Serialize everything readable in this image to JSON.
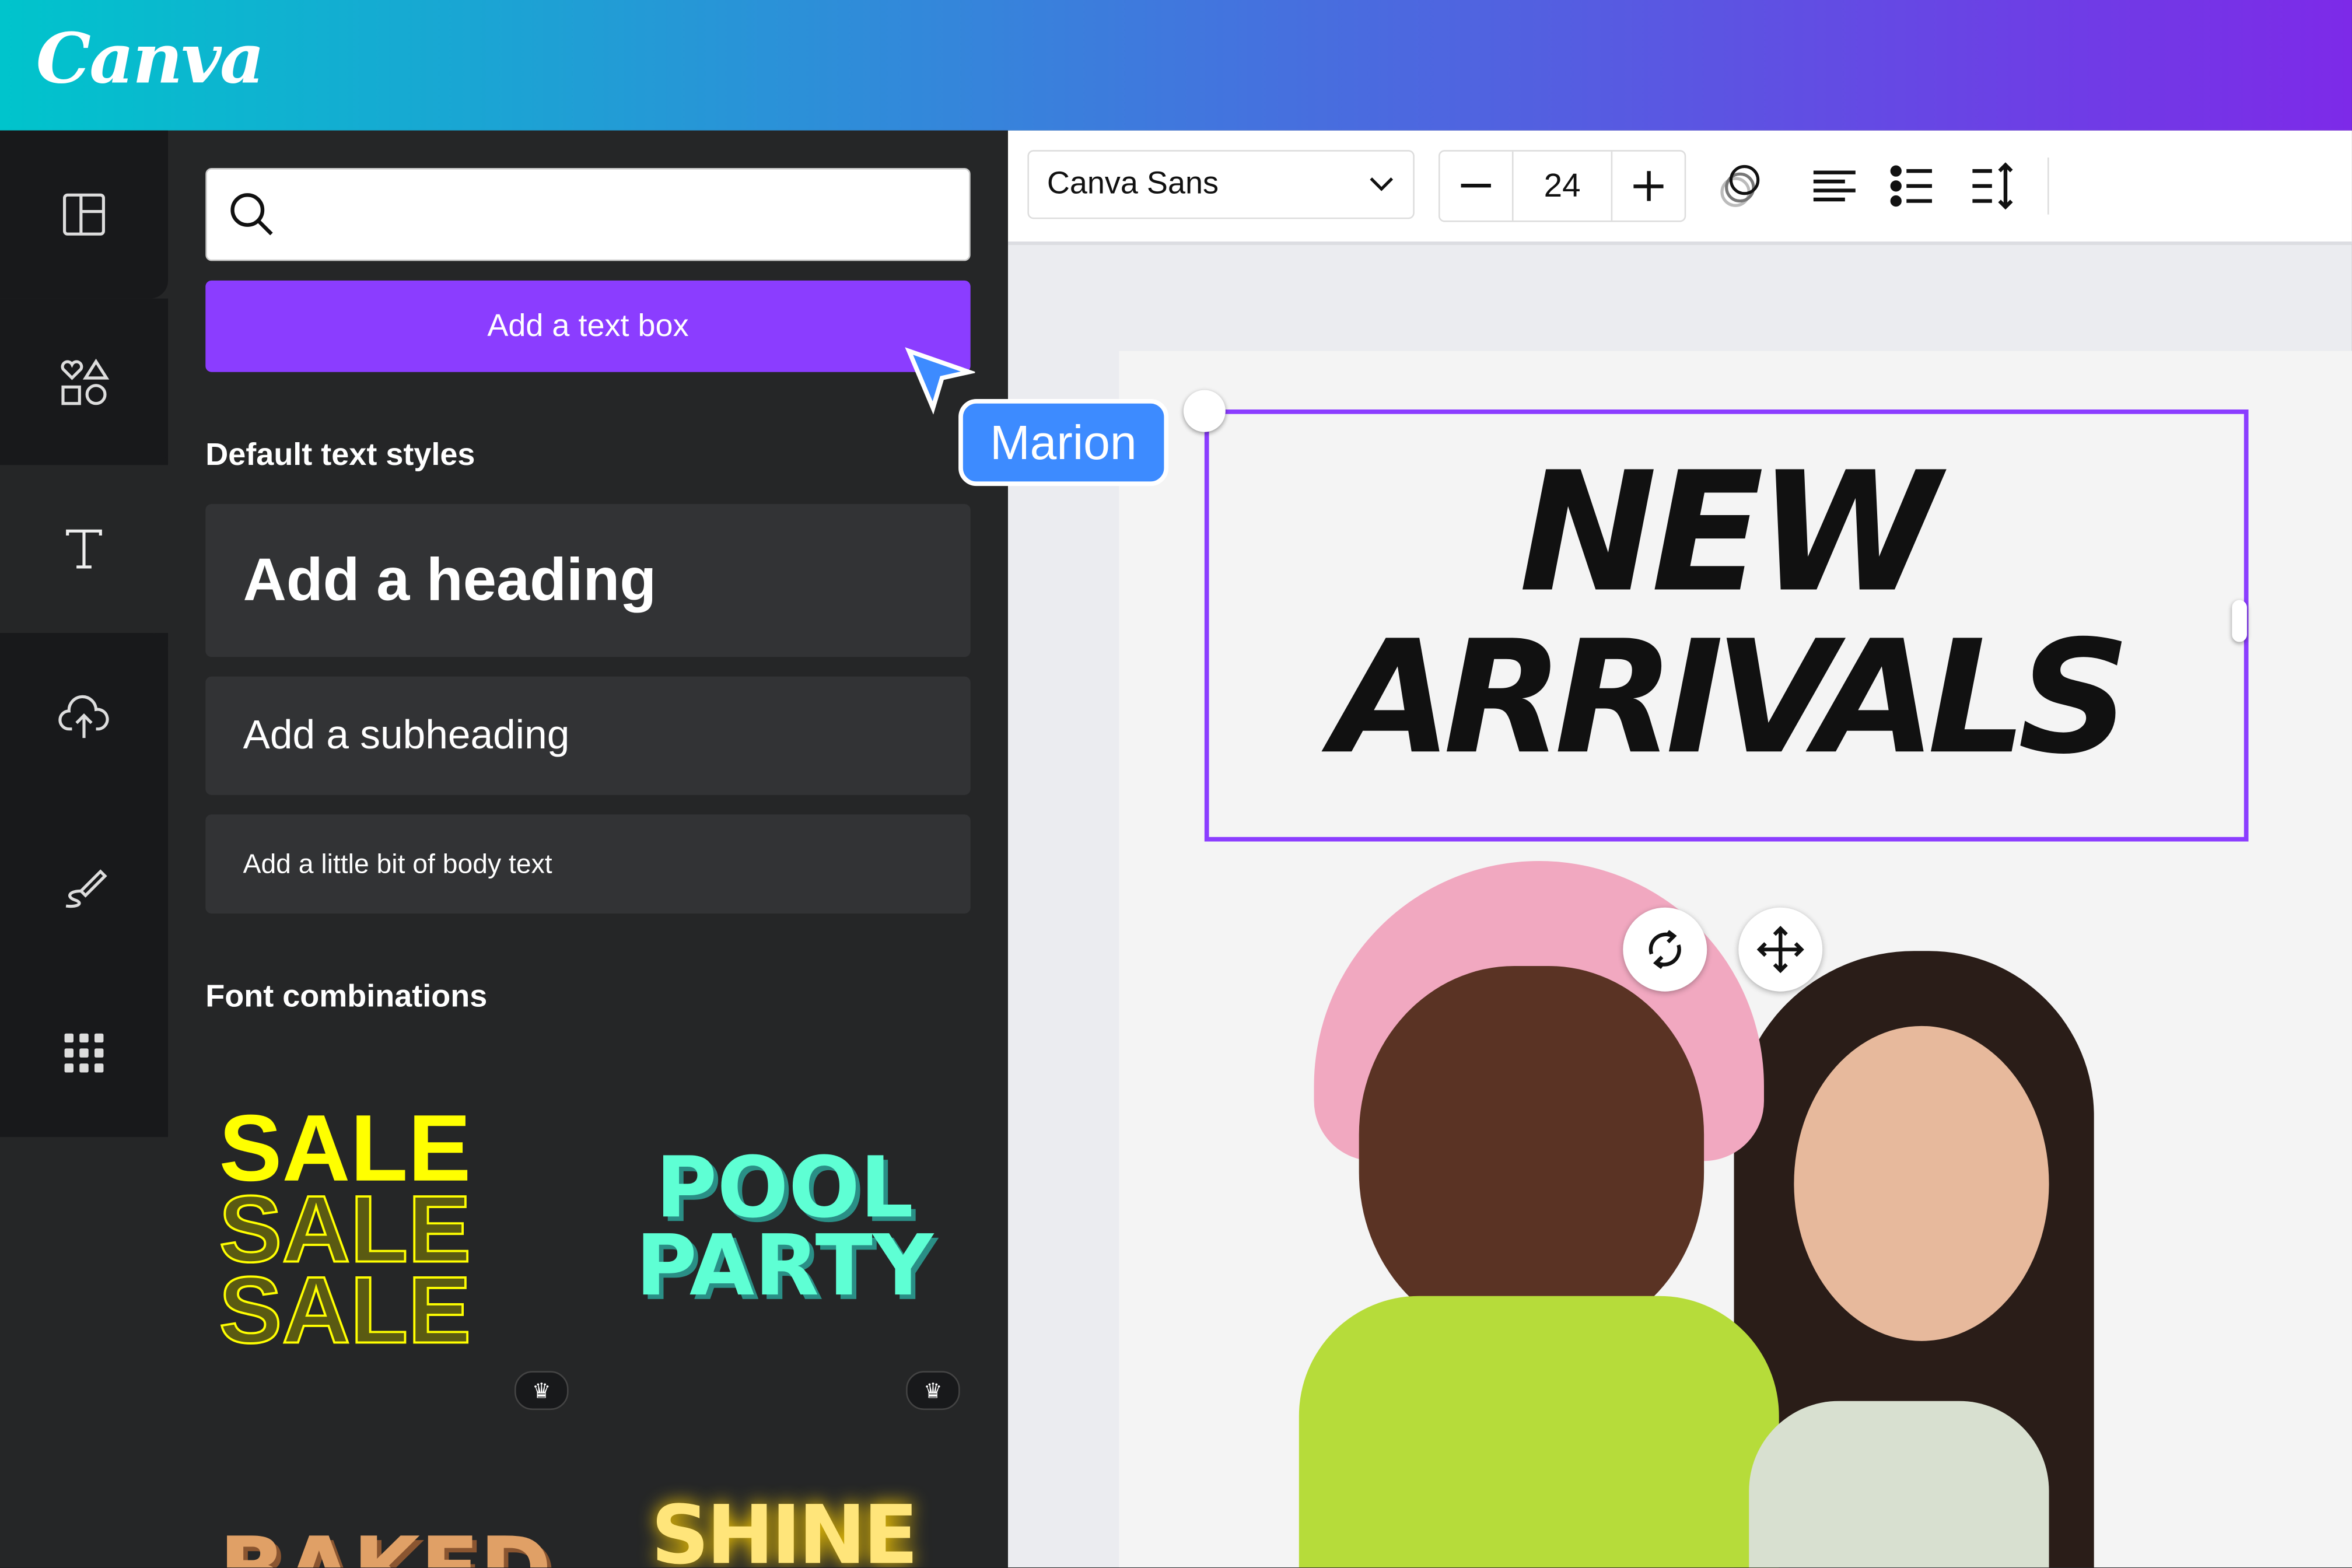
{
  "header": {
    "logo": "Canva",
    "gradient": [
      "#00c4cc",
      "#3a7fdc",
      "#7d2ae8"
    ]
  },
  "rail": {
    "items": [
      {
        "icon": "layout-icon"
      },
      {
        "icon": "elements-icon"
      },
      {
        "icon": "text-icon",
        "active": true
      },
      {
        "icon": "upload-cloud-icon"
      },
      {
        "icon": "draw-icon"
      },
      {
        "icon": "apps-grid-icon"
      }
    ]
  },
  "panel": {
    "search": {
      "value": "",
      "placeholder": ""
    },
    "add_text_box": "Add a text box",
    "default_styles_title": "Default text styles",
    "heading": "Add a heading",
    "subheading": "Add a subheading",
    "body": "Add a little bit of body text",
    "font_combos_title": "Font combinations",
    "combos": [
      {
        "lines": [
          "SALE",
          "SALE",
          "SALE"
        ],
        "color": "#ffff00",
        "premium": true
      },
      {
        "lines": [
          "POOL",
          "PARTY"
        ],
        "color": "#5effd4",
        "premium": true
      },
      {
        "lines": [
          "BAKED"
        ],
        "color": "#e0a066"
      },
      {
        "lines": [
          "SHINE"
        ],
        "color": "#ffe57a"
      }
    ]
  },
  "toolbar": {
    "font": "Canva Sans",
    "font_size": "24"
  },
  "canvas": {
    "headline_line1": "NEW",
    "headline_line2": "ARRIVALS",
    "collaborator": "Marion",
    "accent": "#8b3dff",
    "collaborator_color": "#3d8bff"
  }
}
